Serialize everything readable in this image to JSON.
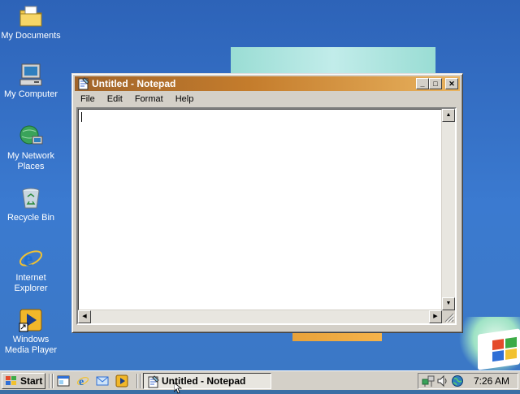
{
  "desktop": {
    "icons": [
      {
        "label": "My Documents",
        "icon": "my-documents-icon"
      },
      {
        "label": "My Computer",
        "icon": "my-computer-icon"
      },
      {
        "label": "My Network Places",
        "icon": "network-places-icon"
      },
      {
        "label": "Recycle Bin",
        "icon": "recycle-bin-icon"
      },
      {
        "label": "Internet Explorer",
        "icon": "internet-explorer-icon"
      },
      {
        "label": "Windows Media Player",
        "icon": "media-player-icon"
      }
    ]
  },
  "window": {
    "title": "Untitled - Notepad",
    "menu": [
      "File",
      "Edit",
      "Format",
      "Help"
    ],
    "content": "",
    "buttons": {
      "minimize": "_",
      "maximize": "□",
      "close": "✕"
    }
  },
  "taskbar": {
    "start_label": "Start",
    "quick_launch": [
      "show-desktop-icon",
      "internet-explorer-icon",
      "outlook-express-icon",
      "media-player-icon"
    ],
    "task_button": "Untitled - Notepad",
    "clock": "7:26 AM",
    "tray_icons": [
      "network-icon",
      "volume-icon",
      "globe-icon"
    ]
  },
  "colors": {
    "desktop": "#3b78c6",
    "title_active_left": "#a0642a",
    "title_active_right": "#e9b35f",
    "selection": "#0a246a",
    "face": "#d4d0c8"
  }
}
